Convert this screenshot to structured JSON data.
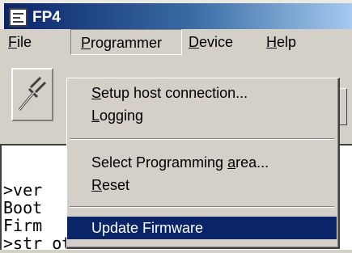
{
  "window": {
    "title": "FP4",
    "icon": "app-icon"
  },
  "menubar": {
    "items": [
      {
        "label": "File",
        "mnemonic": "F",
        "rest": "ile"
      },
      {
        "label": "Programmer",
        "mnemonic": "P",
        "rest": "rogrammer"
      },
      {
        "label": "Device",
        "mnemonic": "D",
        "rest": "evice"
      },
      {
        "label": "Help",
        "mnemonic": "H",
        "rest": "elp"
      }
    ]
  },
  "toolbar": {
    "button_icon": "connect-plug-icon"
  },
  "console": {
    "lines": [
      ">ver",
      "Boot",
      "Firm",
      ">str ott"
    ]
  },
  "dropdown": {
    "items": [
      {
        "label": "Setup host connection...",
        "pre": "",
        "mnemonic": "S",
        "post": "etup host connection..."
      },
      {
        "label": "Logging",
        "pre": "",
        "mnemonic": "L",
        "post": "ogging"
      },
      {
        "label": "Select Programming area...",
        "pre": "Select Programming ",
        "mnemonic": "a",
        "post": "rea..."
      },
      {
        "label": "Reset",
        "pre": "",
        "mnemonic": "R",
        "post": "eset"
      },
      {
        "label": "Update Firmware",
        "pre": "Update Firmware",
        "mnemonic": "",
        "post": ""
      }
    ],
    "selected": "Update Firmware"
  },
  "colors": {
    "title_gradient_start": "#0a246a",
    "selection": "#0a246a",
    "face": "#d4d0c8"
  }
}
